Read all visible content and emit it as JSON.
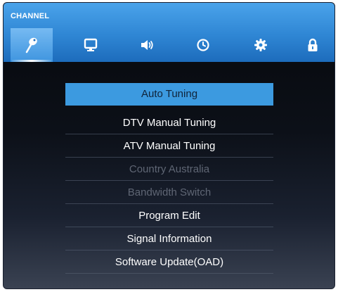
{
  "header": {
    "title": "CHANNEL"
  },
  "tabs": [
    {
      "icon": "satellite-dish-icon",
      "selected": true
    },
    {
      "icon": "monitor-icon",
      "selected": false
    },
    {
      "icon": "speaker-icon",
      "selected": false
    },
    {
      "icon": "clock-icon",
      "selected": false
    },
    {
      "icon": "gear-icon",
      "selected": false
    },
    {
      "icon": "lock-icon",
      "selected": false
    }
  ],
  "menu": {
    "items": [
      {
        "label": "Auto Tuning",
        "selected": true,
        "enabled": true
      },
      {
        "label": "DTV Manual Tuning",
        "selected": false,
        "enabled": true
      },
      {
        "label": "ATV Manual Tuning",
        "selected": false,
        "enabled": true
      },
      {
        "label": "Country Australia",
        "selected": false,
        "enabled": false
      },
      {
        "label": "Bandwidth Switch",
        "selected": false,
        "enabled": false
      },
      {
        "label": "Program Edit",
        "selected": false,
        "enabled": true
      },
      {
        "label": "Signal Information",
        "selected": false,
        "enabled": true
      },
      {
        "label": "Software Update(OAD)",
        "selected": false,
        "enabled": true
      }
    ]
  },
  "colors": {
    "header": "#2f86d4",
    "selected_item": "#3c9ae0",
    "disabled_text": "#5f6674",
    "text": "#ffffff"
  }
}
